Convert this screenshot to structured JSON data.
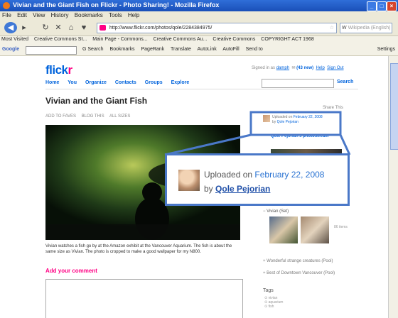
{
  "window": {
    "title": "Vivian and the Giant Fish on Flickr - Photo Sharing! - Mozilla Firefox"
  },
  "menu": [
    "File",
    "Edit",
    "View",
    "History",
    "Bookmarks",
    "Tools",
    "Help"
  ],
  "nav": {
    "url": "http://www.flickr.com/photos/qole/2284384975/",
    "search_placeholder": "Wikipedia (English)"
  },
  "bookmarks": [
    "Most Visited",
    "Creative Commons St...",
    "Main Page - Commons...",
    "Creative Commons Au...",
    "Creative Commons",
    "COPYRIGHT ACT 1968"
  ],
  "google_toolbar": {
    "logo": "Google",
    "items": [
      "G Search",
      "Bookmarks",
      "PageRank",
      "Translate",
      "AutoLink",
      "AutoFill",
      "Send to"
    ],
    "settings": "Settings"
  },
  "flickr": {
    "logo_a": "flick",
    "logo_b": "r",
    "nav_items": [
      "Home",
      "You",
      "Organize",
      "Contacts",
      "Groups",
      "Explore"
    ],
    "signed_in_prefix": "Signed in as",
    "signed_in_user": "damph",
    "inbox": "(43 new)",
    "help": "Help",
    "sign_out": "Sign Out",
    "search_button": "Search"
  },
  "photo": {
    "title": "Vivian and the Giant Fish",
    "tools": [
      "ADD TO FAVES",
      "BLOG THIS",
      "ALL SIZES"
    ],
    "share": "Share This",
    "caption": "Vivian watches a fish go by at the Amazon exhibit at the Vancouver Aquarium. The fish is about the same size as Vivian. The photo is cropped to make a good wallpaper for my N800.",
    "add_comment": "Add your comment"
  },
  "sidebar": {
    "uploaded_prefix": "Uploaded on",
    "date": "February 22, 2008",
    "by": "by",
    "uploader": "Qole Pejorian",
    "photostream": "Qole Pejorian's photostream",
    "set_label": "Vivian (Set)",
    "set_more": "86 items",
    "pool1": "Wonderful strange creatures (Pool)",
    "pool2": "Best of Downtown Vancouver (Pool)",
    "tags_title": "Tags",
    "tags": [
      "vivian",
      "aquarium",
      "fish"
    ]
  }
}
